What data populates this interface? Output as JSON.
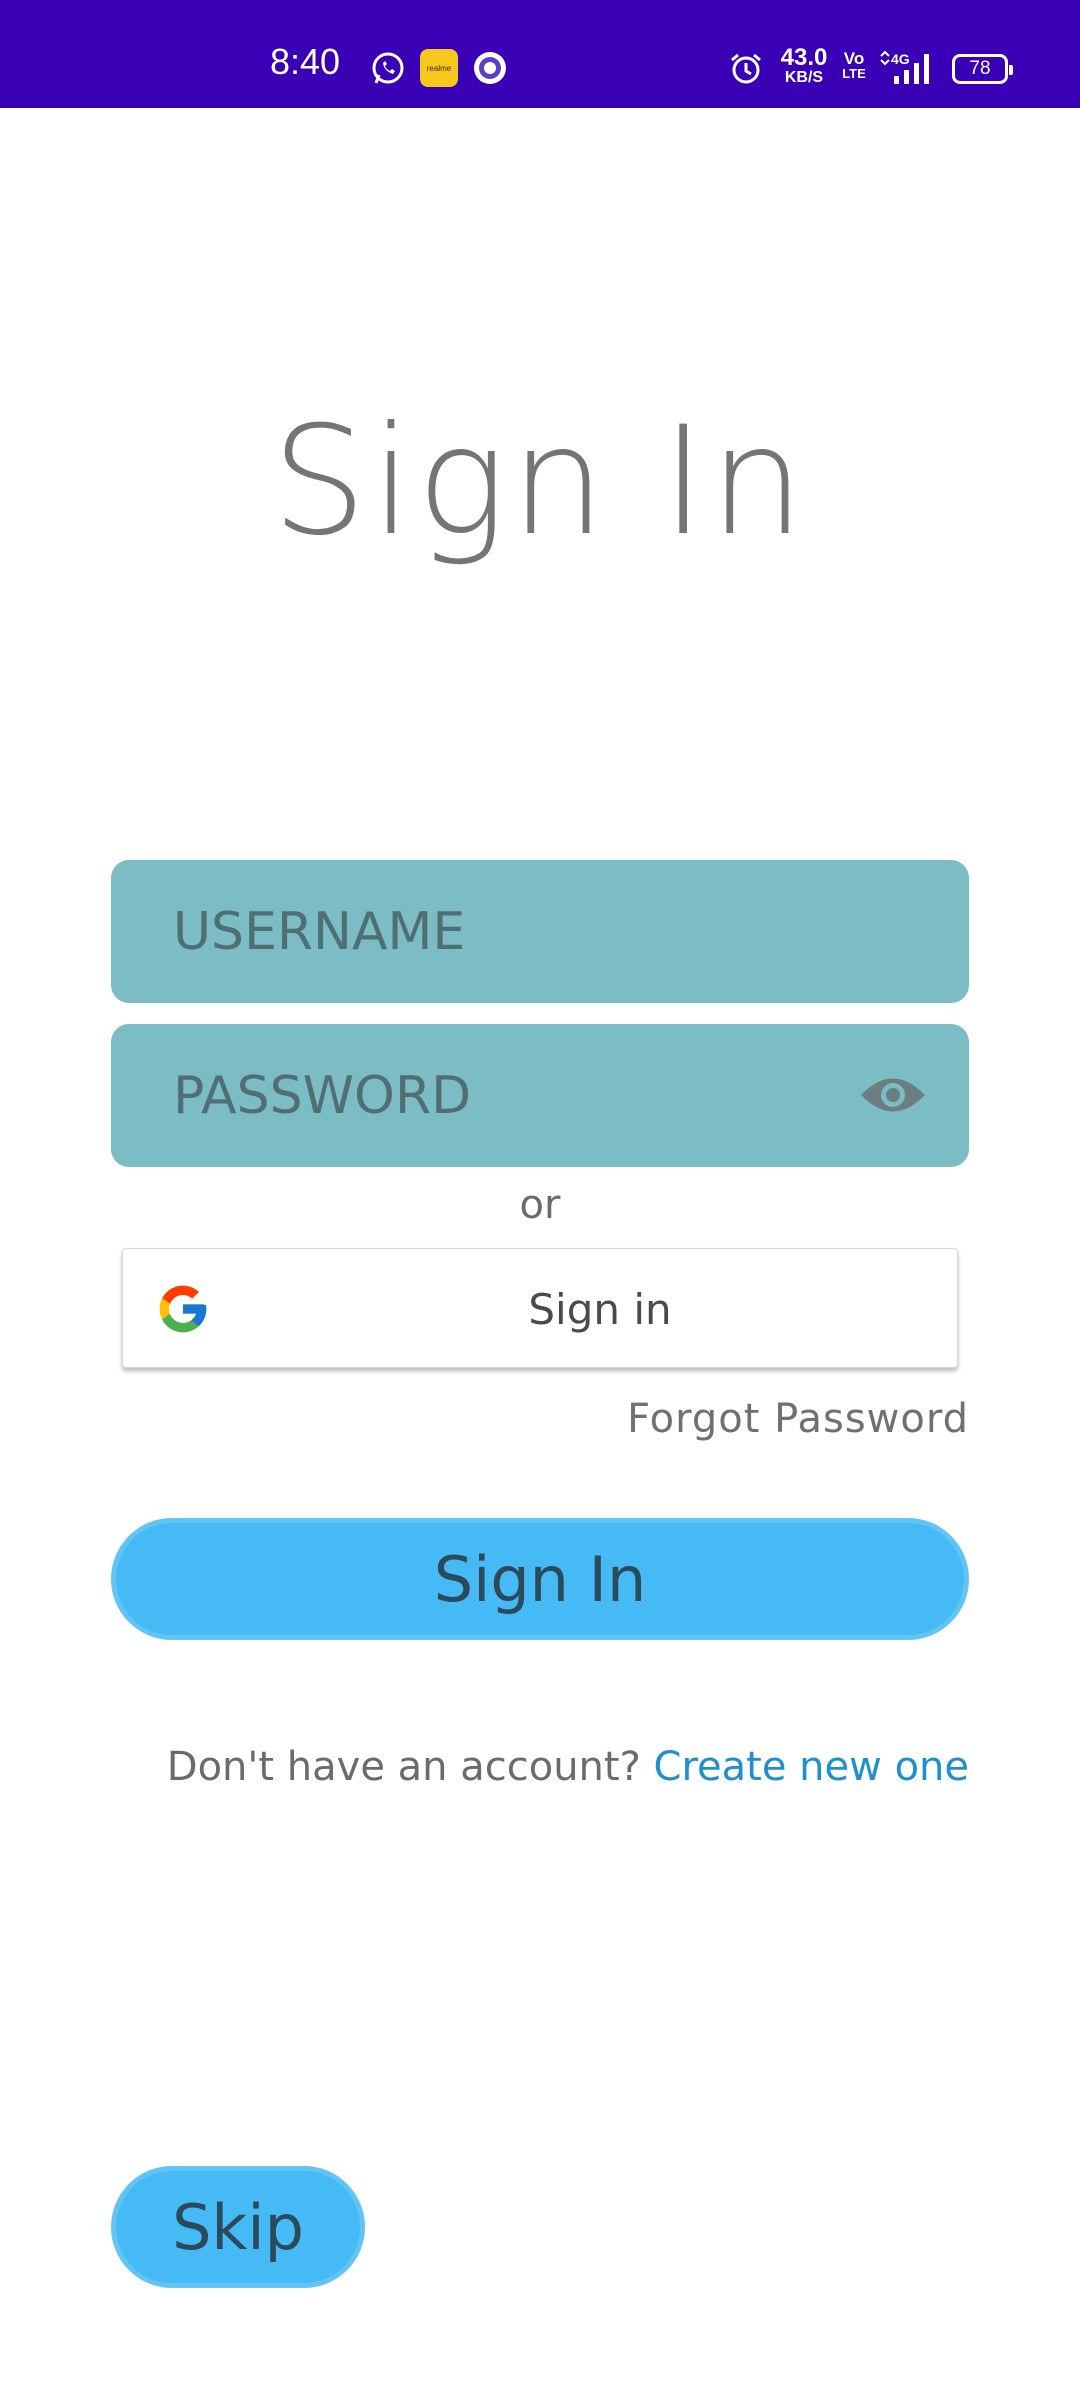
{
  "status_bar": {
    "time": "8:40",
    "app_badge_label": "realme",
    "network_speed_value": "43.0",
    "network_speed_unit": "KB/S",
    "volte_top": "Vo",
    "volte_bottom": "LTE",
    "network_type": "4G",
    "battery_level": "78",
    "icons": [
      "whatsapp-icon",
      "app-badge-icon",
      "circle-app-icon",
      "alarm-icon",
      "signal-icon",
      "battery-icon"
    ]
  },
  "title": "Sign In",
  "form": {
    "username_placeholder": "USERNAME",
    "password_placeholder": "PASSWORD",
    "or_label": "or",
    "google_button_label": "Sign in",
    "forgot_password": "Forgot Password",
    "sign_in_button": "Sign In"
  },
  "signup": {
    "prompt": "Don't have an account?",
    "link": "Create new one"
  },
  "skip_button": "Skip",
  "colors": {
    "status_bar": "#3a00b5",
    "input_bg": "#7bbcc5",
    "button_bg": "#45baf5",
    "link": "#1e8fd0",
    "title": "#757575"
  }
}
